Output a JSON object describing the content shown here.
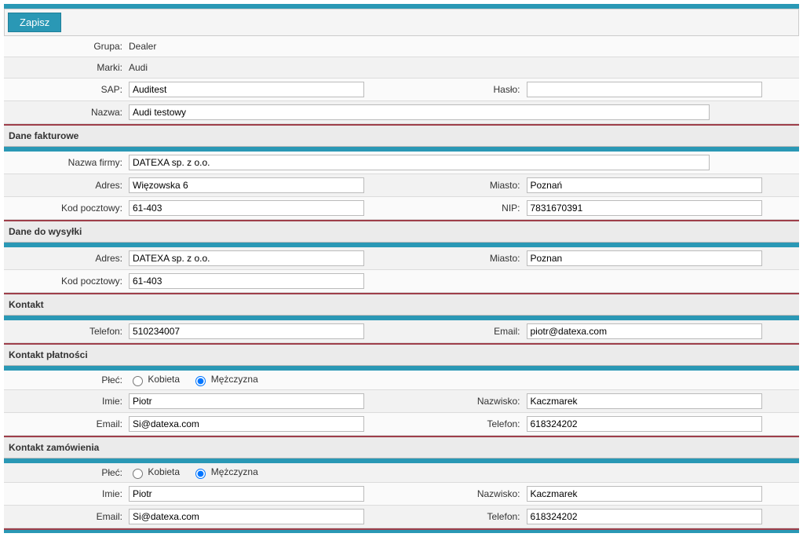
{
  "toolbar": {
    "save_label": "Zapisz"
  },
  "header": {
    "grupa_label": "Grupa:",
    "grupa_value": "Dealer",
    "marki_label": "Marki:",
    "marki_value": "Audi",
    "sap_label": "SAP:",
    "sap_value": "Auditest",
    "haslo_label": "Hasło:",
    "haslo_value": "",
    "nazwa_label": "Nazwa:",
    "nazwa_value": "Audi testowy"
  },
  "sections": {
    "invoice": {
      "title": "Dane fakturowe",
      "nazwa_firmy_label": "Nazwa firmy:",
      "nazwa_firmy_value": "DATEXA sp. z o.o.",
      "adres_label": "Adres:",
      "adres_value": "Więzowska 6",
      "miasto_label": "Miasto:",
      "miasto_value": "Poznań",
      "kod_label": "Kod pocztowy:",
      "kod_value": "61-403",
      "nip_label": "NIP:",
      "nip_value": "7831670391"
    },
    "shipping": {
      "title": "Dane do wysyłki",
      "adres_label": "Adres:",
      "adres_value": "DATEXA sp. z o.o.",
      "miasto_label": "Miasto:",
      "miasto_value": "Poznan",
      "kod_label": "Kod pocztowy:",
      "kod_value": "61-403"
    },
    "contact": {
      "title": "Kontakt",
      "telefon_label": "Telefon:",
      "telefon_value": "510234007",
      "email_label": "Email:",
      "email_value": "piotr@datexa.com"
    },
    "payment": {
      "title": "Kontakt płatności",
      "plec_label": "Płeć:",
      "kobieta_label": "Kobieta",
      "mezczyzna_label": "Mężczyzna",
      "plec_value": "m",
      "imie_label": "Imie:",
      "imie_value": "Piotr",
      "nazwisko_label": "Nazwisko:",
      "nazwisko_value": "Kaczmarek",
      "email_label": "Email:",
      "email_value": "Si@datexa.com",
      "telefon_label": "Telefon:",
      "telefon_value": "618324202"
    },
    "order": {
      "title": "Kontakt zamówienia",
      "plec_label": "Płeć:",
      "kobieta_label": "Kobieta",
      "mezczyzna_label": "Mężczyzna",
      "plec_value": "m",
      "imie_label": "Imie:",
      "imie_value": "Piotr",
      "nazwisko_label": "Nazwisko:",
      "nazwisko_value": "Kaczmarek",
      "email_label": "Email:",
      "email_value": "Si@datexa.com",
      "telefon_label": "Telefon:",
      "telefon_value": "618324202"
    }
  }
}
